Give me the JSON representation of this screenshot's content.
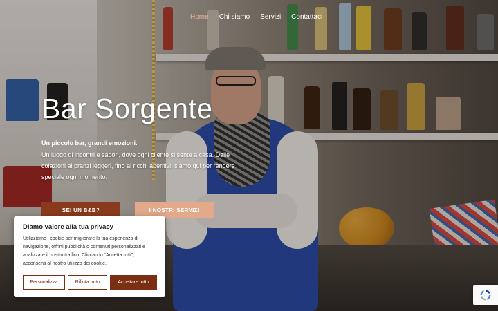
{
  "nav": {
    "items": [
      {
        "label": "Home",
        "active": true
      },
      {
        "label": "Chi siamo",
        "active": false
      },
      {
        "label": "Servizi",
        "active": false
      },
      {
        "label": "Contattaci",
        "active": false
      }
    ]
  },
  "hero": {
    "title": "Bar Sorgente",
    "tagline": "Un piccolo bar, grandi emozioni.",
    "intro": "Un luogo di incontri e sapori, dove ogni cliente si sente a casa. Dalle colazioni ai pranzi leggeri, fino ai ricchi aperitivi, siamo qui per rendere speciale ogni momento.",
    "cta_bb": "SEI UN B&B?",
    "cta_services": "I NOSTRI SERVIZI"
  },
  "cookie": {
    "title": "Diamo valore alla tua privacy",
    "text": "Utilizziamo i cookie per migliorare la tua esperienza di navigazione, offrirti pubblicità o contenuti personalizzati e analizzare il nostro traffico. Cliccando “Accetta tutti”, acconsenti al nostro utilizzo dei cookie.",
    "customize_label": "Personalizza",
    "reject_label": "Rifiuta tutto",
    "accept_label": "Accettare tutto"
  },
  "colors": {
    "accent_dark": "#7a2e12",
    "accent_light": "#e2a98a",
    "nav_active": "#e9b29a"
  },
  "icons": {
    "recaptcha": "recaptcha-icon"
  }
}
